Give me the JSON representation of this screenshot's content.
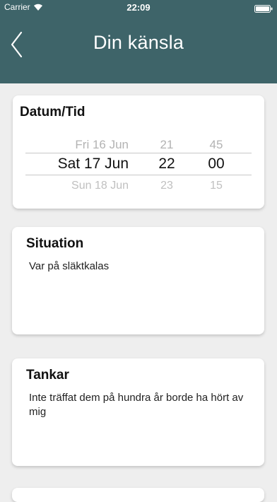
{
  "status_bar": {
    "carrier": "Carrier",
    "time": "22:09"
  },
  "nav": {
    "title": "Din känsla",
    "back_icon": "chevron-left-icon"
  },
  "date_card": {
    "title": "Datum/Tid",
    "picker": {
      "previous": {
        "day": "Fri 16 Jun",
        "hour": "21",
        "minute": "45"
      },
      "selected": {
        "day": "Sat 17 Jun",
        "hour": "22",
        "minute": "00"
      },
      "next": {
        "day": "Sun 18 Jun",
        "hour": "23",
        "minute": "15"
      }
    }
  },
  "situation_card": {
    "title": "Situation",
    "text": "Var på släktkalas"
  },
  "thoughts_card": {
    "title": "Tankar",
    "text": "Inte träffat dem på hundra år borde ha hört av mig"
  },
  "colors": {
    "header_background": "#3e6469",
    "page_background": "#eeeeee",
    "card_background": "#ffffff"
  }
}
